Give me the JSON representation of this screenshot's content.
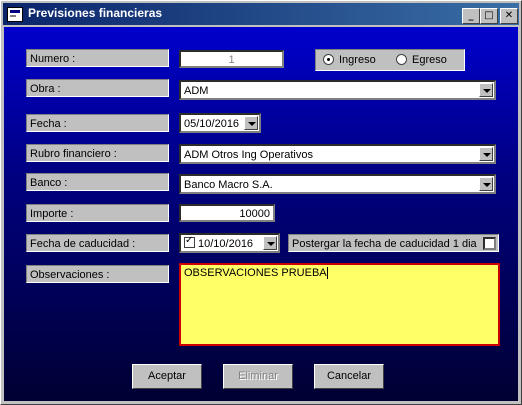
{
  "window": {
    "title": "Previsiones financieras",
    "minimize_icon": "minimize-icon",
    "maximize_icon": "maximize-icon",
    "close_icon": "close-icon"
  },
  "labels": {
    "numero": "Numero :",
    "obra": "Obra :",
    "fecha": "Fecha :",
    "rubro": "Rubro financiero :",
    "banco": "Banco :",
    "importe": "Importe :",
    "fecha_caducidad": "Fecha de caducidad :",
    "observaciones": "Observaciones :"
  },
  "fields": {
    "numero": "1",
    "obra": "ADM",
    "fecha": "05/10/2016",
    "rubro": "ADM Otros Ing Operativos",
    "banco": "Banco Macro S.A.",
    "importe": "10000",
    "fecha_caducidad": "10/10/2016",
    "fecha_caducidad_checked": true,
    "observaciones": "OBSERVACIONES PRUEBA"
  },
  "tipo": {
    "ingreso": "Ingreso",
    "egreso": "Egreso",
    "selected": "Ingreso"
  },
  "postergar": {
    "label": "Postergar la fecha de caducidad 1 dia",
    "checked": false
  },
  "buttons": {
    "aceptar": "Aceptar",
    "eliminar": "Eliminar",
    "cancelar": "Cancelar"
  },
  "colors": {
    "title_bar": "#0a246a",
    "background_top": "#0000cc",
    "background_bottom": "#000033",
    "observaciones_bg": "#ffff66",
    "observaciones_border": "#cc0000"
  }
}
